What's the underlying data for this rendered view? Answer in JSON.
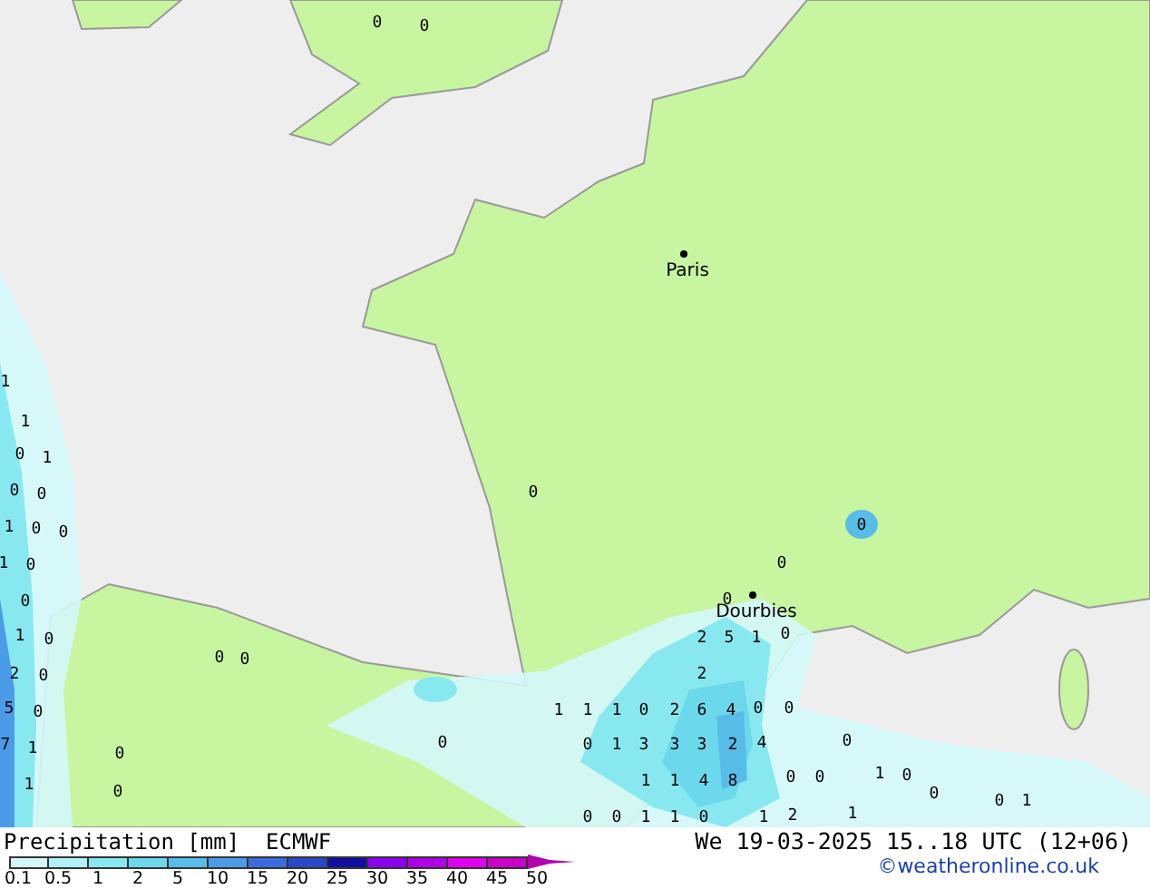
{
  "map": {
    "cities": [
      {
        "name": "Paris"
      },
      {
        "name": "Dourbies"
      }
    ],
    "values": [
      "0",
      "0",
      "1",
      "1",
      "0",
      "1",
      "0",
      "0",
      "1",
      "0",
      "0",
      "1",
      "0",
      "0",
      "1",
      "0",
      "2",
      "0",
      "5",
      "0",
      "7",
      "1",
      "1",
      "0",
      "0",
      "0",
      "0",
      "0",
      "0",
      "0",
      "0",
      "0",
      "2",
      "5",
      "1",
      "0",
      "2",
      "1",
      "1",
      "1",
      "0",
      "2",
      "6",
      "4",
      "0",
      "0",
      "0",
      "1",
      "3",
      "3",
      "3",
      "2",
      "4",
      "0",
      "1",
      "1",
      "4",
      "8",
      "0",
      "0",
      "1",
      "0",
      "0",
      "0",
      "1",
      "0",
      "0",
      "1",
      "1",
      "0",
      "1",
      "2",
      "1"
    ]
  },
  "legend": {
    "title": "Precipitation [mm]  ECMWF",
    "date": "We 19-03-2025 15..18 UTC (12+06)",
    "credit": "©weatheronline.co.uk",
    "colors": [
      {
        "color": "#d4f8fa"
      },
      {
        "color": "#b0f0f8"
      },
      {
        "color": "#88e8f0"
      },
      {
        "color": "#6cd8ec"
      },
      {
        "color": "#58bce8"
      },
      {
        "color": "#4a9ce8"
      },
      {
        "color": "#3a6ce0"
      },
      {
        "color": "#2a48c8"
      },
      {
        "color": "#1010a0"
      },
      {
        "color": "#8c00f0"
      },
      {
        "color": "#b000e8"
      },
      {
        "color": "#e000f0"
      },
      {
        "color": "#c800c8"
      }
    ],
    "ticks": [
      "0.1",
      "0.5",
      "1",
      "2",
      "5",
      "10",
      "15",
      "20",
      "25",
      "30",
      "35",
      "40",
      "45",
      "50"
    ]
  }
}
